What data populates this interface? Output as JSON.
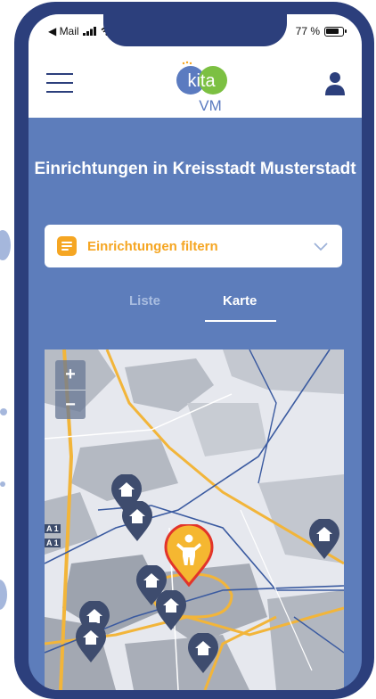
{
  "status": {
    "back_label": "◀ Mail",
    "battery": "77 %"
  },
  "header": {
    "logo_top": "kita",
    "logo_bottom": "VM"
  },
  "title": "Einrichtungen in Kreisstadt Musterstadt",
  "filter": {
    "label": "Einrichtungen filtern"
  },
  "tabs": [
    {
      "label": "Liste",
      "active": false
    },
    {
      "label": "Karte",
      "active": true
    }
  ],
  "map": {
    "zoom_in": "+",
    "zoom_out": "−",
    "road_labels": [
      "A 1",
      "A 1"
    ]
  },
  "colors": {
    "accent": "#f5a623",
    "frame": "#2c3f7c",
    "background_blue": "#5d7dbb",
    "pin": "#3e4c6e",
    "selected_pin": "#e2342a"
  }
}
